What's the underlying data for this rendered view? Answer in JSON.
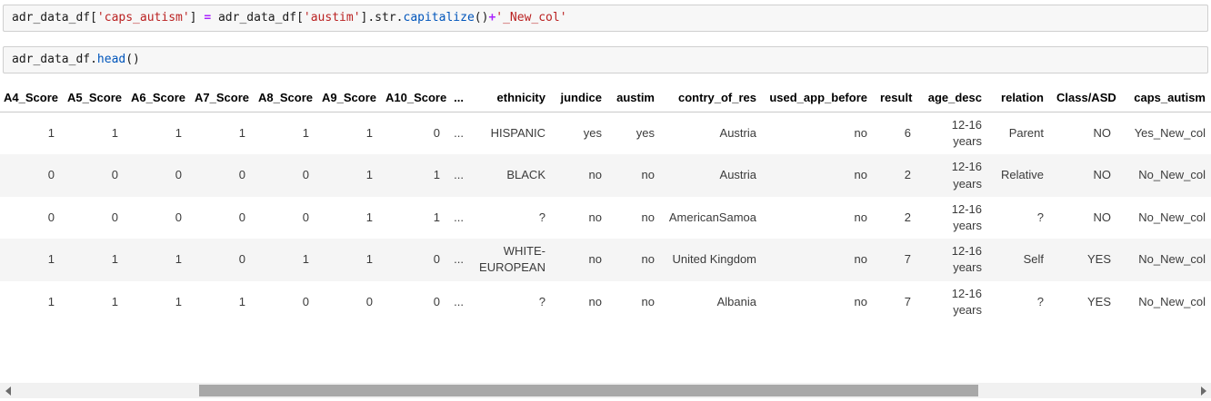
{
  "colors": {
    "code_plain": "#1a1a1a",
    "code_string": "#ba2121",
    "code_operator": "#aa22ff",
    "code_function": "#0055bb",
    "cell_background": "#f7f7f7",
    "cell_border": "#cfcfcf",
    "row_stripe": "#f5f5f5",
    "scrollbar_track": "#f1f1f1",
    "scrollbar_thumb": "#a8a8a8"
  },
  "code_cells": [
    {
      "source": "adr_data_df['caps_autism'] = adr_data_df['austim'].str.capitalize()+'_New_col'",
      "tokens": [
        {
          "t": "adr_data_df",
          "c": "plain"
        },
        {
          "t": "[",
          "c": "plain"
        },
        {
          "t": "'caps_autism'",
          "c": "string"
        },
        {
          "t": "] ",
          "c": "plain"
        },
        {
          "t": "=",
          "c": "op"
        },
        {
          "t": " adr_data_df",
          "c": "plain"
        },
        {
          "t": "[",
          "c": "plain"
        },
        {
          "t": "'austim'",
          "c": "string"
        },
        {
          "t": "].str.",
          "c": "plain"
        },
        {
          "t": "capitalize",
          "c": "func"
        },
        {
          "t": "()",
          "c": "plain"
        },
        {
          "t": "+",
          "c": "op"
        },
        {
          "t": "'_New_col'",
          "c": "string"
        }
      ]
    },
    {
      "source": "adr_data_df.head()",
      "tokens": [
        {
          "t": "adr_data_df.",
          "c": "plain"
        },
        {
          "t": "head",
          "c": "func"
        },
        {
          "t": "()",
          "c": "plain"
        }
      ]
    }
  ],
  "table": {
    "columns": [
      "A4_Score",
      "A5_Score",
      "A6_Score",
      "A7_Score",
      "A8_Score",
      "A9_Score",
      "A10_Score",
      "...",
      "ethnicity",
      "jundice",
      "austim",
      "contry_of_res",
      "used_app_before",
      "result",
      "age_desc",
      "relation",
      "Class/ASD",
      "caps_autism"
    ],
    "rows": [
      [
        "1",
        "1",
        "1",
        "1",
        "1",
        "1",
        "0",
        "...",
        "HISPANIC",
        "yes",
        "yes",
        "Austria",
        "no",
        "6",
        "12-16 years",
        "Parent",
        "NO",
        "Yes_New_col"
      ],
      [
        "0",
        "0",
        "0",
        "0",
        "0",
        "1",
        "1",
        "...",
        "BLACK",
        "no",
        "no",
        "Austria",
        "no",
        "2",
        "12-16 years",
        "Relative",
        "NO",
        "No_New_col"
      ],
      [
        "0",
        "0",
        "0",
        "0",
        "0",
        "1",
        "1",
        "...",
        "?",
        "no",
        "no",
        "AmericanSamoa",
        "no",
        "2",
        "12-16 years",
        "?",
        "NO",
        "No_New_col"
      ],
      [
        "1",
        "1",
        "1",
        "0",
        "1",
        "1",
        "0",
        "...",
        "WHITE-EUROPEAN",
        "no",
        "no",
        "United Kingdom",
        "no",
        "7",
        "12-16 years",
        "Self",
        "YES",
        "No_New_col"
      ],
      [
        "1",
        "1",
        "1",
        "1",
        "0",
        "0",
        "0",
        "...",
        "?",
        "no",
        "no",
        "Albania",
        "no",
        "7",
        "12-16 years",
        "?",
        "YES",
        "No_New_col"
      ]
    ]
  }
}
